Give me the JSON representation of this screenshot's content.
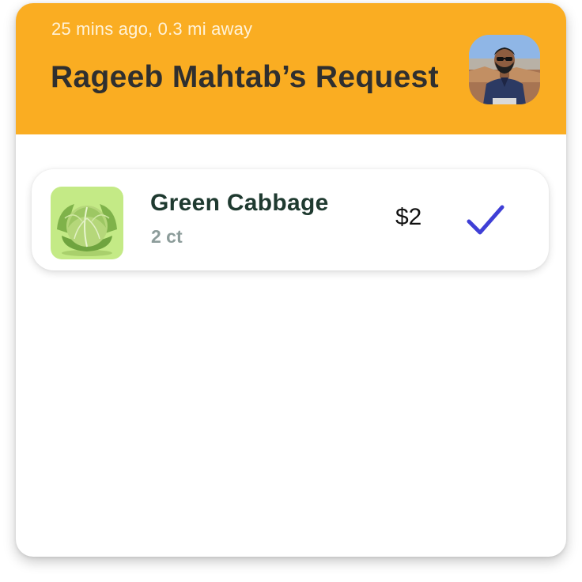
{
  "request": {
    "meta": "25 mins ago, 0.3 mi away",
    "title": "Rageeb Mahtab’s Request",
    "avatar_alt": "Rageeb Mahtab"
  },
  "items": [
    {
      "name": "Green Cabbage",
      "quantity": "2 ct",
      "price": "$2",
      "icon": "cabbage-image",
      "selected": true
    }
  ],
  "colors": {
    "header": "#FAAD22",
    "check": "#3F3FD6",
    "thumb_bg": "#C4EA86"
  }
}
